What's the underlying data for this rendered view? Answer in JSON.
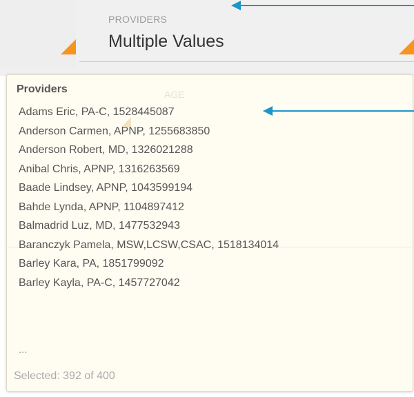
{
  "filter": {
    "label": "PROVIDERS",
    "value": "Multiple Values"
  },
  "ghost": {
    "age_label": "AGE"
  },
  "tooltip": {
    "title": "Providers",
    "items": [
      "Adams Eric, PA-C, 1528445087",
      "Anderson Carmen, APNP, 1255683850",
      "Anderson Robert, MD, 1326021288",
      "Anibal Chris, APNP, 1316263569",
      "Baade Lindsey, APNP, 1043599194",
      "Bahde Lynda, APNP, 1104897412",
      "Balmadrid Luz, MD, 1477532943",
      "Baranczyk Pamela, MSW,LCSW,CSAC, 1518134014",
      "Barley Kara, PA, 1851799092",
      "Barley Kayla, PA-C, 1457727042"
    ],
    "more": "...",
    "selected": "Selected: 392 of 400"
  },
  "colors": {
    "accent": "#f7941d",
    "annotation": "#1a96c9",
    "tooltip_bg": "#fffdf2"
  }
}
